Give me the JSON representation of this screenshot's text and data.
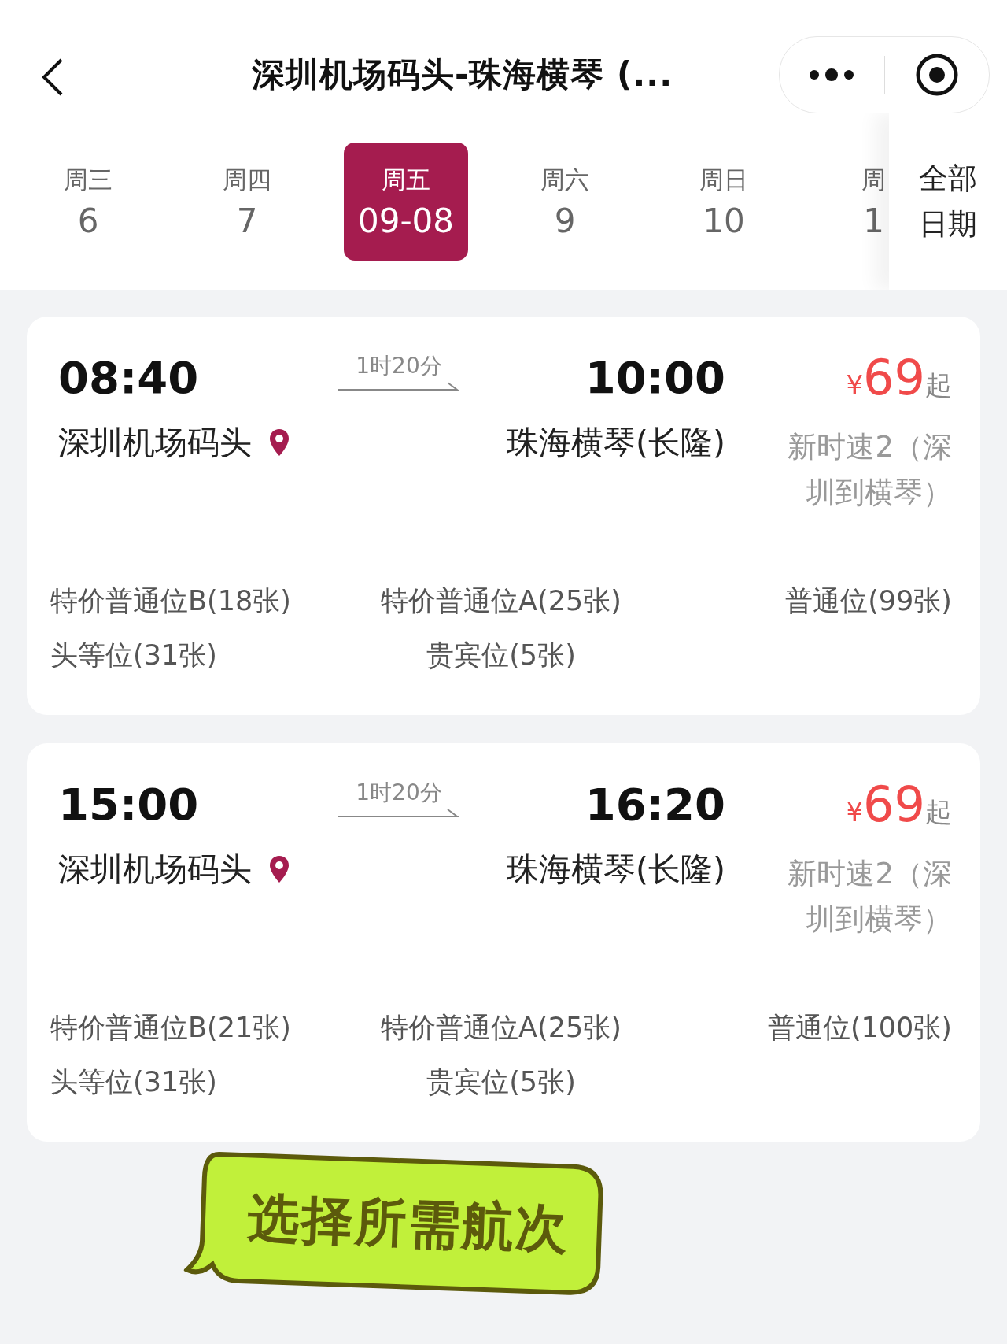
{
  "header": {
    "title": "深圳机场码头-珠海横琴 (..."
  },
  "date_tabs": [
    {
      "weekday": "周三",
      "day": "6",
      "selected": false
    },
    {
      "weekday": "周四",
      "day": "7",
      "selected": false
    },
    {
      "weekday": "周五",
      "day": "09-08",
      "selected": true
    },
    {
      "weekday": "周六",
      "day": "9",
      "selected": false
    },
    {
      "weekday": "周日",
      "day": "10",
      "selected": false
    },
    {
      "weekday": "周",
      "day": "1",
      "selected": false
    }
  ],
  "all_dates": "全部日期",
  "trips": [
    {
      "depart_time": "08:40",
      "duration": "1时20分",
      "arrive_time": "10:00",
      "price_symbol": "¥",
      "price": "69",
      "price_suffix": "起",
      "depart_station": "深圳机场码头",
      "arrive_station": "珠海横琴(长隆)",
      "vessel": "新时速2（深圳到横琴）",
      "seats": [
        "特价普通位B(18张)",
        "特价普通位A(25张)",
        "普通位(99张)",
        "头等位(31张)",
        "贵宾位(5张)"
      ]
    },
    {
      "depart_time": "15:00",
      "duration": "1时20分",
      "arrive_time": "16:20",
      "price_symbol": "¥",
      "price": "69",
      "price_suffix": "起",
      "depart_station": "深圳机场码头",
      "arrive_station": "珠海横琴(长隆)",
      "vessel": "新时速2（深圳到横琴）",
      "seats": [
        "特价普通位B(21张)",
        "特价普通位A(25张)",
        "普通位(100张)",
        "头等位(31张)",
        "贵宾位(5张)"
      ]
    }
  ],
  "callout": "选择所需航次"
}
